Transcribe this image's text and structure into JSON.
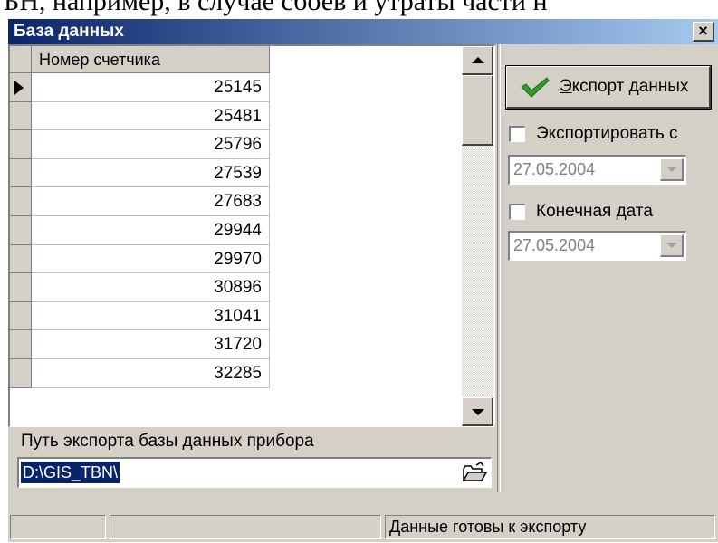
{
  "background_text": "БН, например, в случае сбоев и утраты части н",
  "window": {
    "title": "База данных",
    "close_glyph": "×"
  },
  "grid": {
    "column_header": "Номер счетчика",
    "rows": [
      "25145",
      "25481",
      "25796",
      "27539",
      "27683",
      "29944",
      "29970",
      "30896",
      "31041",
      "31720",
      "32285"
    ],
    "current_row_index": 0
  },
  "export_button": {
    "hotkey": "Э",
    "label_rest": "кспорт данных",
    "icon": "checkmark-icon",
    "icon_color": "#2e9e2e"
  },
  "export_from": {
    "label": "Экспортировать с",
    "checked": false,
    "date": "27.05.2004"
  },
  "end_date": {
    "label": "Конечная дата",
    "checked": false,
    "date": "27.05.2004"
  },
  "path": {
    "label": "Путь экспорта базы данных прибора",
    "value": "D:\\GIS_TBN\\",
    "browse_icon": "open-folder-icon"
  },
  "status": {
    "panel1": "",
    "panel2": "",
    "panel3": "Данные готовы к экспорту"
  },
  "colors": {
    "face": "#d4d0c8",
    "title_start": "#0a246a",
    "title_end": "#a6caf0",
    "selection": "#0a246a"
  }
}
